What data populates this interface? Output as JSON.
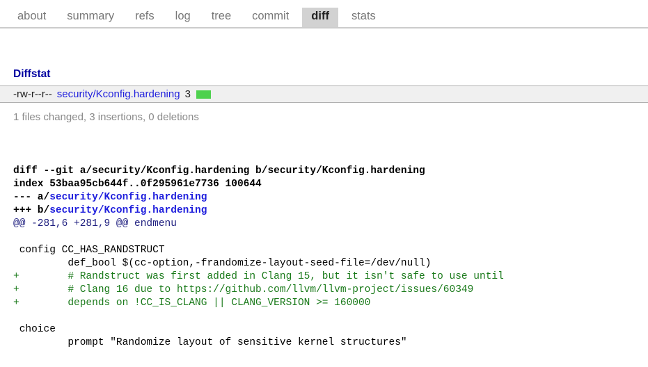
{
  "nav": {
    "tabs": [
      {
        "label": "about",
        "active": false
      },
      {
        "label": "summary",
        "active": false
      },
      {
        "label": "refs",
        "active": false
      },
      {
        "label": "log",
        "active": false
      },
      {
        "label": "tree",
        "active": false
      },
      {
        "label": "commit",
        "active": false
      },
      {
        "label": "diff",
        "active": true
      },
      {
        "label": "stats",
        "active": false
      }
    ]
  },
  "diffstat": {
    "heading": "Diffstat",
    "rows": [
      {
        "mode": "-rw-r--r--",
        "file": "security/Kconfig.hardening",
        "changes": "3",
        "graph_added": 3,
        "graph_deleted": 0
      }
    ],
    "summary": "1 files changed, 3 insertions, 0 deletions"
  },
  "diff": {
    "lines": [
      {
        "kind": "head",
        "prefix": "diff --git a/security/Kconfig.hardening b/security/Kconfig.hardening",
        "path": ""
      },
      {
        "kind": "head",
        "prefix": "index 53baa95cb644f..0f295961e7736 100644",
        "path": ""
      },
      {
        "kind": "head",
        "prefix": "--- a/",
        "path": "security/Kconfig.hardening"
      },
      {
        "kind": "head",
        "prefix": "+++ b/",
        "path": "security/Kconfig.hardening"
      },
      {
        "kind": "hunk",
        "text": "@@ -281,6 +281,9 @@ endmenu"
      },
      {
        "kind": "blank",
        "text": ""
      },
      {
        "kind": "ctx",
        "text": " config CC_HAS_RANDSTRUCT"
      },
      {
        "kind": "ctx",
        "text": "         def_bool $(cc-option,-frandomize-layout-seed-file=/dev/null)"
      },
      {
        "kind": "add",
        "text": "+        # Randstruct was first added in Clang 15, but it isn't safe to use until"
      },
      {
        "kind": "add",
        "text": "+        # Clang 16 due to https://github.com/llvm/llvm-project/issues/60349"
      },
      {
        "kind": "add",
        "text": "+        depends on !CC_IS_CLANG || CLANG_VERSION >= 160000"
      },
      {
        "kind": "blank",
        "text": ""
      },
      {
        "kind": "ctx",
        "text": " choice"
      },
      {
        "kind": "ctx",
        "text": "         prompt \"Randomize layout of sensitive kernel structures\""
      }
    ]
  },
  "colors": {
    "link": "#1f1fdd",
    "heading": "#0000a0",
    "added_text": "#1a7a1a",
    "added_graph": "#4ed14e",
    "hunk": "#202080",
    "active_tab_bg": "#d2d2d2",
    "row_bg": "#f0f0f0",
    "muted": "#8a8a8a"
  }
}
